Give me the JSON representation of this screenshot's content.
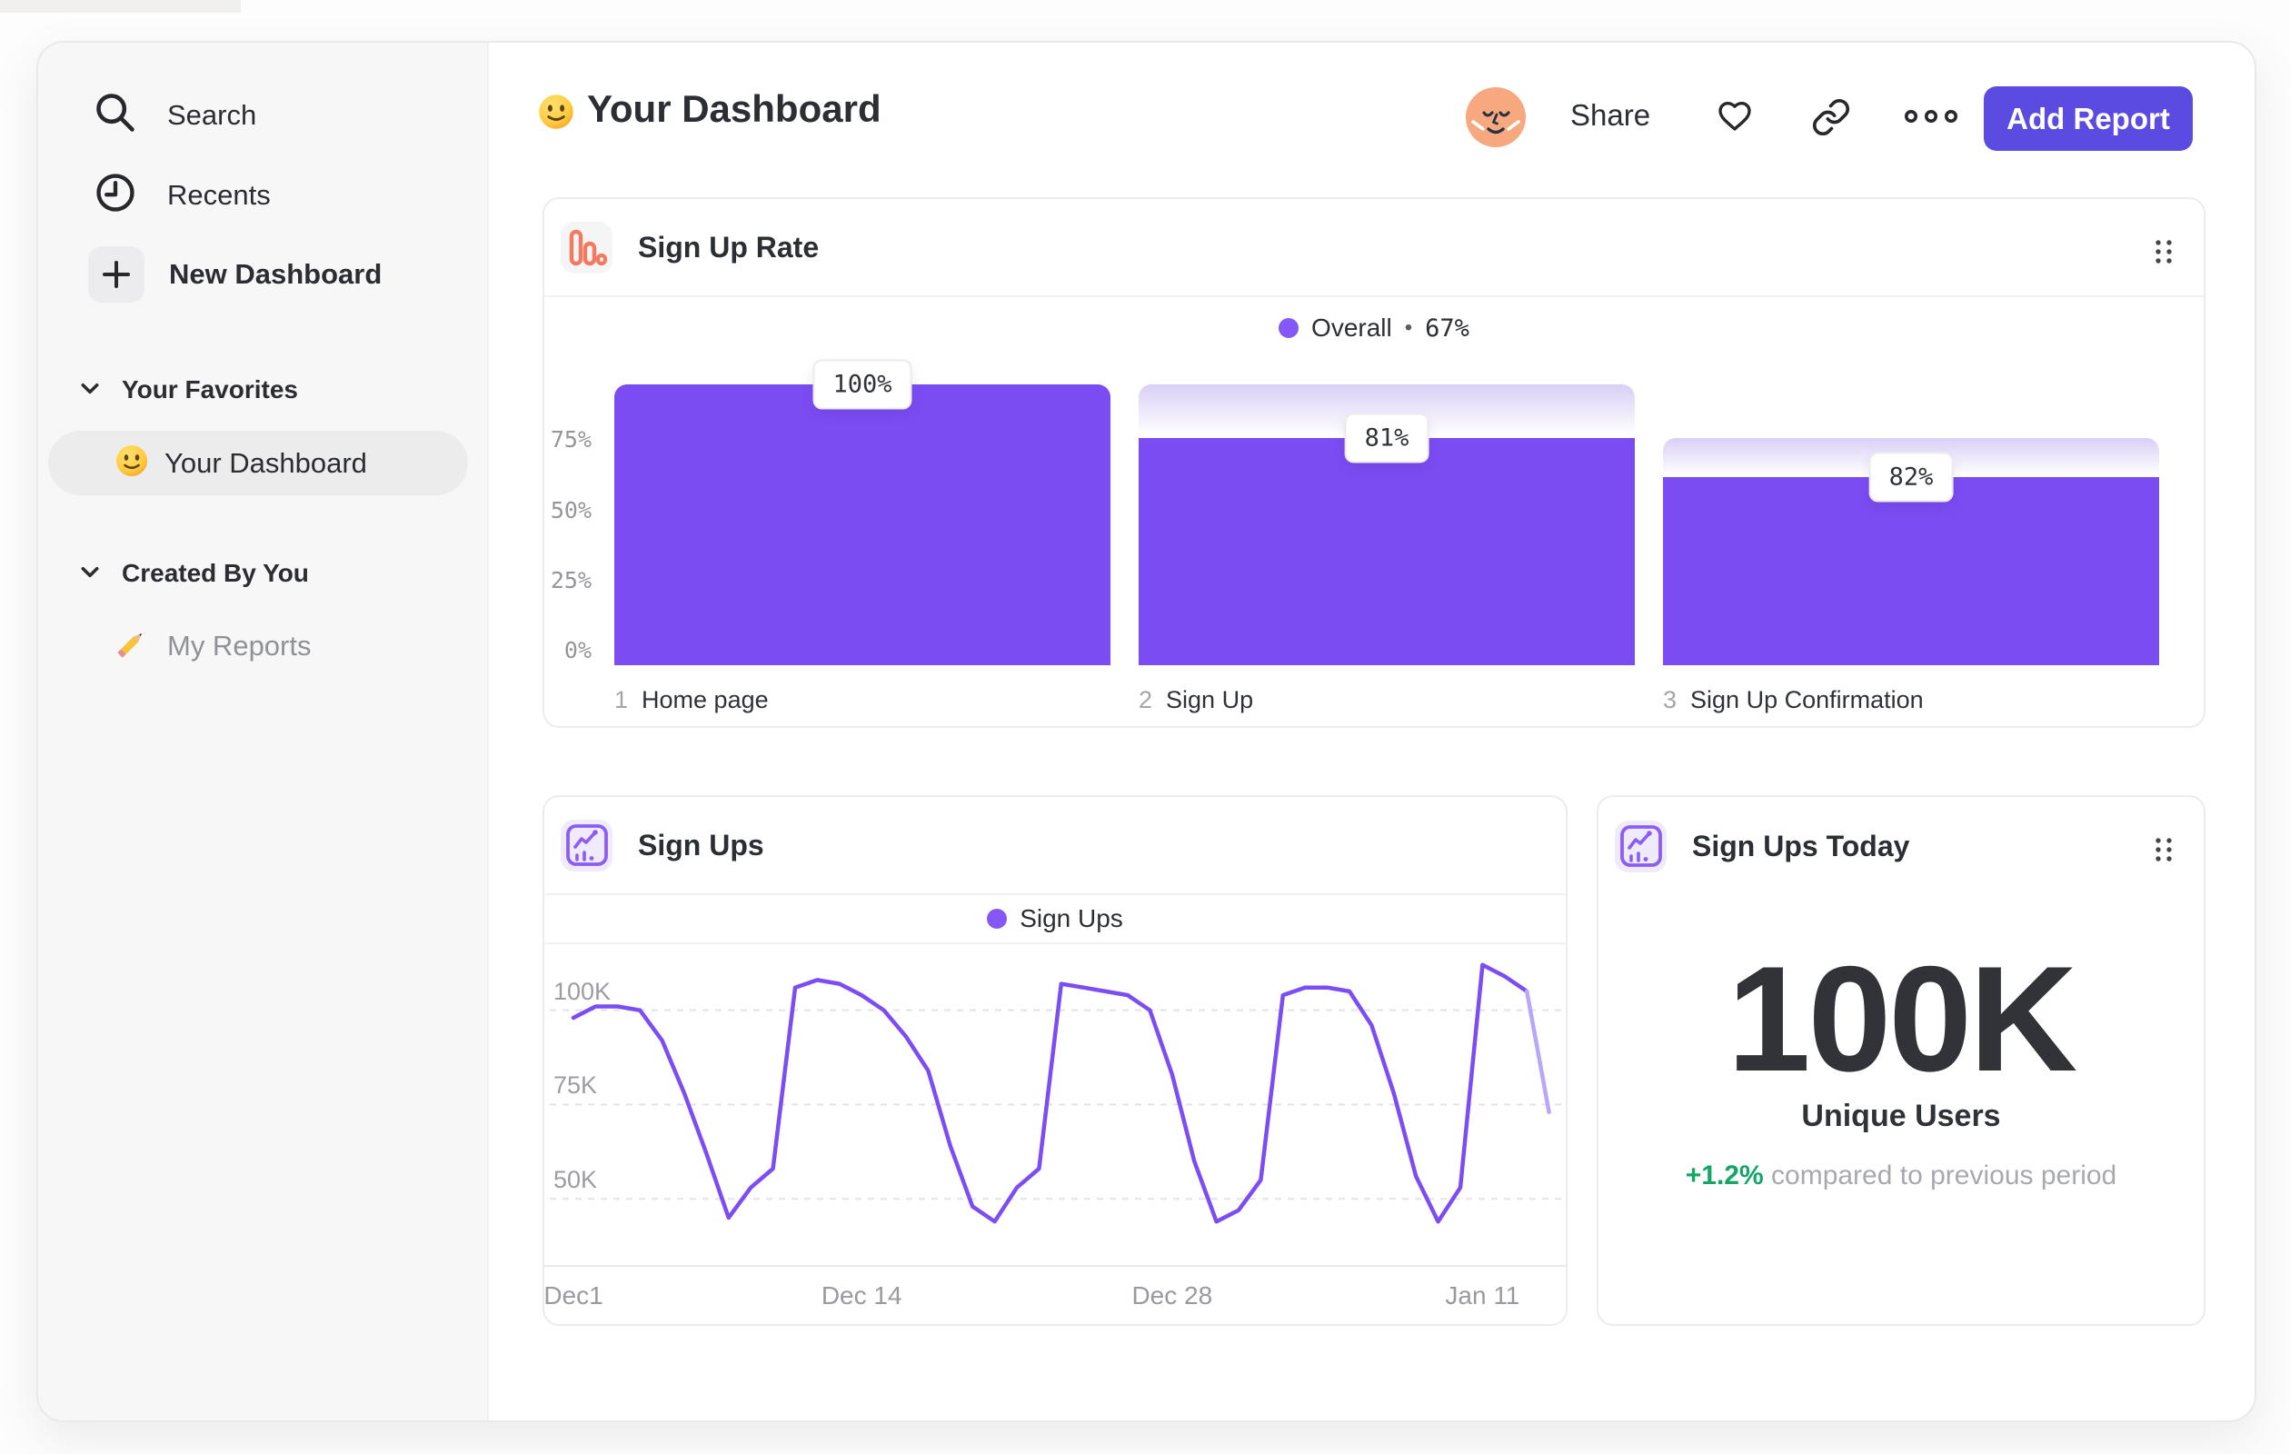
{
  "sidebar": {
    "items": [
      {
        "label": "Search",
        "icon": "search-icon"
      },
      {
        "label": "Recents",
        "icon": "clock-icon"
      },
      {
        "label": "New Dashboard",
        "icon": "plus-icon"
      }
    ],
    "sections": [
      {
        "label": "Your Favorites",
        "icon": "chevron-down-icon",
        "items": [
          {
            "label": "Your Dashboard",
            "icon": "smiley-emoji",
            "selected": true
          }
        ]
      },
      {
        "label": "Created By You",
        "icon": "chevron-down-icon",
        "items": [
          {
            "label": "My Reports",
            "icon": "pencil-emoji",
            "selected": false
          }
        ]
      }
    ]
  },
  "header": {
    "title": "Your Dashboard",
    "title_icon": "smiley-emoji",
    "avatar": "peach-face-avatar",
    "share_label": "Share",
    "icons": [
      "heart-icon",
      "link-icon",
      "ellipsis-icon"
    ],
    "add_report_label": "Add Report"
  },
  "colors": {
    "accent_purple": "#7c4cf3",
    "legend_purple": "#8557f4",
    "gradient_top": "#d9cff6",
    "button_indigo": "#5b4be1",
    "icon_orange": "#f37a5f",
    "icon_purple": "#8b5cf6",
    "delta_green": "#12a765",
    "sidebar_bg": "#f7f7f8",
    "fade_line": "#b9a6f8"
  },
  "chart_data": [
    {
      "type": "bar",
      "subtype": "funnel",
      "title": "Sign Up Rate",
      "title_icon": "funnel-bars-icon",
      "legend": {
        "label": "Overall",
        "separator": "•",
        "value": "67%",
        "color": "#8557f4"
      },
      "ylabel": "",
      "xlabel": "",
      "y_ticks": [
        {
          "label": "75%",
          "value": 75
        },
        {
          "label": "50%",
          "value": 50
        },
        {
          "label": "25%",
          "value": 25
        },
        {
          "label": "0%",
          "value": 0
        }
      ],
      "ylim": [
        0,
        100
      ],
      "grid": false,
      "bar_color": "#7c4cf3",
      "steps": [
        {
          "index": "1",
          "label": "Home page",
          "conversion_label": "100%",
          "conversion_pct": 100,
          "overall_height_pct": 100,
          "gradient_from_pct": null
        },
        {
          "index": "2",
          "label": "Sign Up",
          "conversion_label": "81%",
          "conversion_pct": 81,
          "overall_height_pct": 81,
          "gradient_from_pct": 100
        },
        {
          "index": "3",
          "label": "Sign Up Confirmation",
          "conversion_label": "82%",
          "conversion_pct": 82,
          "overall_height_pct": 67,
          "gradient_from_pct": 81
        }
      ]
    },
    {
      "type": "line",
      "title": "Sign Ups",
      "title_icon": "line-chart-icon",
      "legend_label": "Sign Ups",
      "legend_color": "#8557f4",
      "line_color": "#7b4df3",
      "fade_color": "#b9a6f8",
      "grid": "dashed-horizontal",
      "y_unit": "K",
      "y_ticks": [
        {
          "label": "100K",
          "value": 100
        },
        {
          "label": "75K",
          "value": 75
        },
        {
          "label": "50K",
          "value": 50
        }
      ],
      "y_domain": {
        "top_value": 117.5,
        "bottom_value": 32
      },
      "x_ticks": [
        {
          "label": "Dec1",
          "day": 0
        },
        {
          "label": "Dec 14",
          "day": 13
        },
        {
          "label": "Dec 28",
          "day": 27
        },
        {
          "label": "Jan 11",
          "day": 41
        }
      ],
      "x_start_day": 0,
      "values_unit": "thousands of sign ups per day",
      "values": [
        98,
        101,
        101,
        100,
        92,
        78,
        62,
        45,
        53,
        58,
        106,
        108,
        107,
        104,
        100,
        93,
        84,
        64,
        48,
        44,
        53,
        58,
        107,
        106,
        105,
        104,
        100,
        83,
        60,
        44,
        47,
        55,
        104,
        106,
        106,
        105,
        96,
        78,
        56,
        44,
        53,
        112,
        109,
        105,
        73
      ],
      "fade_from_index": 43
    },
    {
      "type": "metric",
      "title": "Sign Ups Today",
      "title_icon": "line-chart-icon",
      "value": "100K",
      "label": "Unique Users",
      "delta": "+1.2%",
      "delta_color": "#12a765",
      "comparison": "compared to previous period"
    }
  ]
}
